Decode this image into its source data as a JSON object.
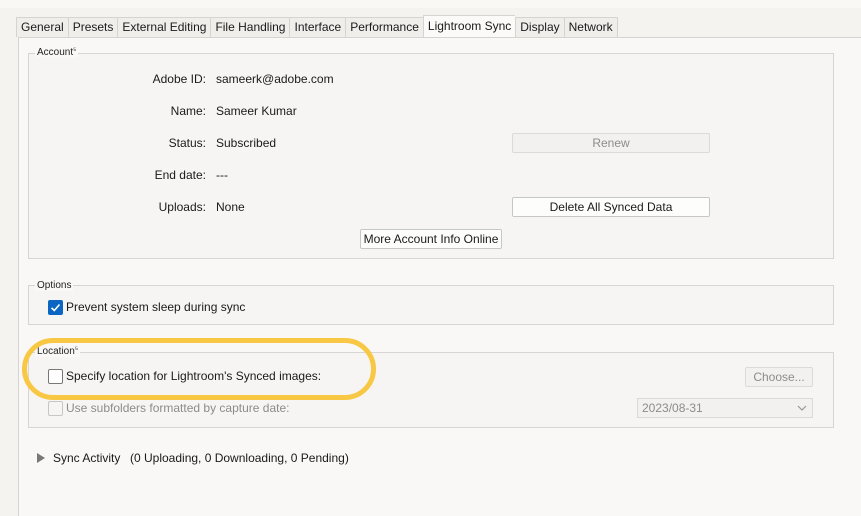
{
  "tabs": [
    {
      "label": "General"
    },
    {
      "label": "Presets"
    },
    {
      "label": "External Editing"
    },
    {
      "label": "File Handling"
    },
    {
      "label": "Interface"
    },
    {
      "label": "Performance"
    },
    {
      "label": "Lightroom Sync",
      "active": true
    },
    {
      "label": "Display"
    },
    {
      "label": "Network"
    }
  ],
  "account": {
    "title": "Account",
    "title_mark": "⁵",
    "adobe_id_label": "Adobe ID:",
    "adobe_id_value": "sameerk@adobe.com",
    "name_label": "Name:",
    "name_value": "Sameer Kumar",
    "status_label": "Status:",
    "status_value": "Subscribed",
    "end_date_label": "End date:",
    "end_date_value": "---",
    "uploads_label": "Uploads:",
    "uploads_value": "None",
    "renew_button": "Renew",
    "delete_button": "Delete All Synced Data",
    "more_info_button": "More Account Info Online"
  },
  "options": {
    "title": "Options",
    "prevent_sleep_label": "Prevent system sleep during sync",
    "prevent_sleep_checked": true
  },
  "location": {
    "title": "Location",
    "title_mark": "⁵",
    "specify_label": "Specify location for Lightroom's Synced images:",
    "specify_checked": false,
    "choose_button": "Choose...",
    "subfolders_label": "Use subfolders formatted by capture date:",
    "subfolders_checked": false,
    "date_format_value": "2023/08-31"
  },
  "sync_activity": {
    "label": "Sync Activity",
    "status": "(0 Uploading, 0 Downloading, 0 Pending)"
  },
  "colors": {
    "highlight": "#f8c845",
    "checkbox_accent": "#0a66c2"
  }
}
